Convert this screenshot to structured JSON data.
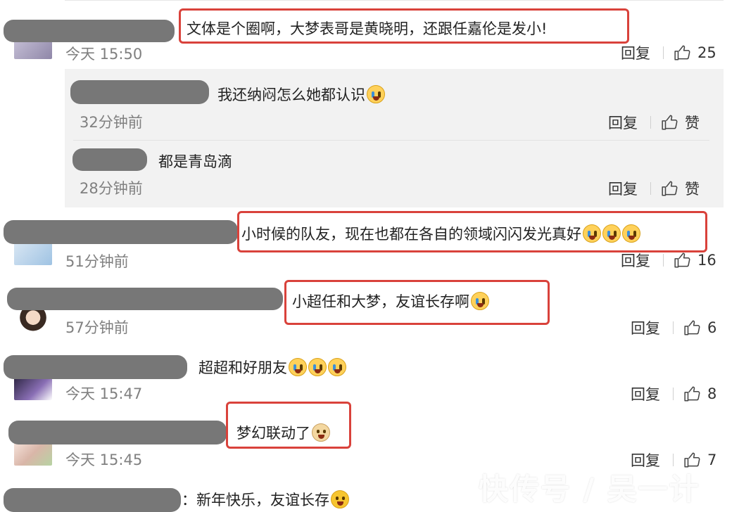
{
  "actions": {
    "reply_label": "回复",
    "like_label": "赞"
  },
  "comments": [
    {
      "text": "文体是个圈啊，大梦表哥是黄晓明，还跟任嘉伦是发小!",
      "time": "今天 15:50",
      "likes": "25"
    },
    {
      "text": "小时候的队友，现在也都在各自的领域闪闪发光真好",
      "time": "51分钟前",
      "likes": "16",
      "emoji": [
        "crying-face-icon",
        "crying-face-icon",
        "crying-face-icon"
      ]
    },
    {
      "text": "小超任和大梦，友谊长存啊",
      "time": "57分钟前",
      "likes": "6",
      "emoji": [
        "crying-face-icon"
      ]
    },
    {
      "text": "超超和好朋友",
      "time": "今天 15:47",
      "likes": "8",
      "emoji": [
        "crying-face-icon",
        "crying-face-icon",
        "crying-face-icon"
      ]
    },
    {
      "text": "梦幻联动了",
      "time": "今天 15:45",
      "likes": "7",
      "emoji": [
        "doge-icon"
      ]
    },
    {
      "text": "：新年快乐，友谊长存",
      "emoji": [
        "sweat-face-icon"
      ]
    }
  ],
  "replies": [
    {
      "text": "我还纳闷怎么她都认识",
      "time": "32分钟前",
      "emoji": [
        "tear-face-icon"
      ]
    },
    {
      "text": "都是青岛滴",
      "time": "28分钟前"
    }
  ],
  "watermark": "快传号 / 吴一计",
  "colors": {
    "highlight": "#d9423b",
    "reply_bg": "#f2f2f2",
    "secondary_text": "#808080"
  }
}
